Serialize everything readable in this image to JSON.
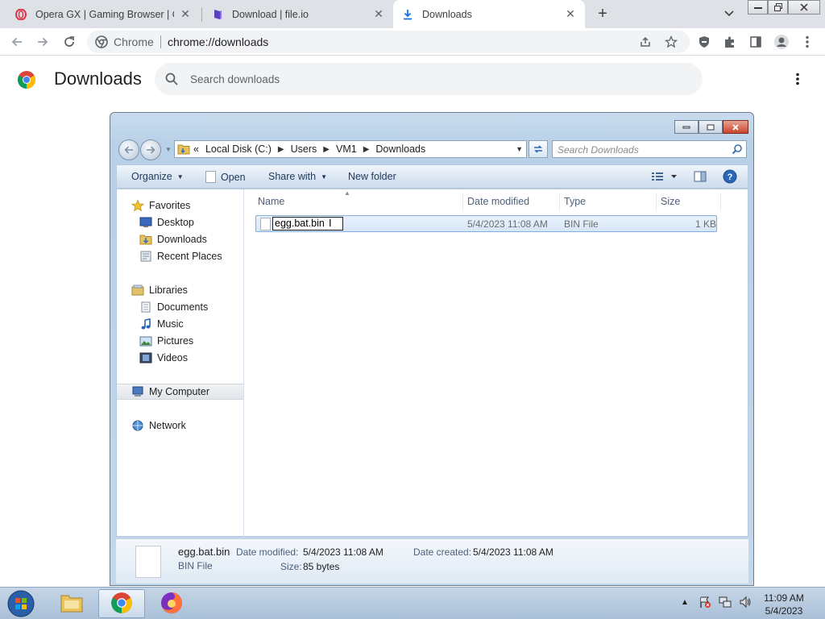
{
  "tabs": [
    {
      "title": "Opera GX | Gaming Browser | Opera",
      "icon": "opera-icon"
    },
    {
      "title": "Download | file.io",
      "icon": "fileio-icon"
    },
    {
      "title": "Downloads",
      "icon": "download-icon",
      "active": true
    }
  ],
  "omnibox": {
    "scheme": "Chrome",
    "url": "chrome://downloads"
  },
  "downloads_page": {
    "title": "Downloads",
    "search_placeholder": "Search downloads"
  },
  "explorer": {
    "breadcrumb": [
      "Local Disk (C:)",
      "Users",
      "VM1",
      "Downloads"
    ],
    "breadcrumb_prefix": "«",
    "search_placeholder": "Search Downloads",
    "commands": {
      "organize": "Organize",
      "open": "Open",
      "share_with": "Share with",
      "new_folder": "New folder"
    },
    "nav": {
      "favorites": "Favorites",
      "favorites_items": [
        "Desktop",
        "Downloads",
        "Recent Places"
      ],
      "libraries": "Libraries",
      "libraries_items": [
        "Documents",
        "Music",
        "Pictures",
        "Videos"
      ],
      "my_computer": "My Computer",
      "network": "Network"
    },
    "columns": {
      "name": "Name",
      "date_modified": "Date modified",
      "type": "Type",
      "size": "Size"
    },
    "files": [
      {
        "name": "egg.bat.bin",
        "date_modified": "5/4/2023 11:08 AM",
        "type": "BIN File",
        "size": "1 KB"
      }
    ],
    "details": {
      "name": "egg.bat.bin",
      "type": "BIN File",
      "date_modified_label": "Date modified:",
      "date_modified": "5/4/2023 11:08 AM",
      "date_created_label": "Date created:",
      "date_created": "5/4/2023 11:08 AM",
      "size_label": "Size:",
      "size": "85 bytes"
    }
  },
  "taskbar": {
    "time": "11:09 AM",
    "date": "5/4/2023"
  }
}
